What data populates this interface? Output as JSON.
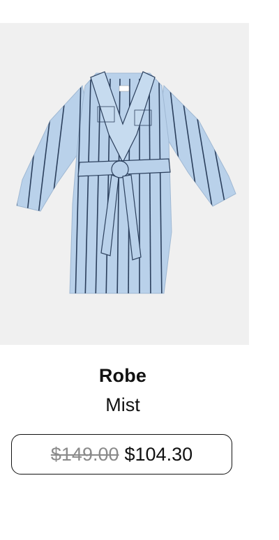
{
  "product": {
    "image_alt": "robe-product-image",
    "title": "Robe",
    "variant": "Mist",
    "original_price": "$149.00",
    "sale_price": "$104.30",
    "colors": {
      "robe": "#b9d1ea",
      "stripe": "#2b3f5c",
      "image_background": "#f0f0f0"
    }
  }
}
